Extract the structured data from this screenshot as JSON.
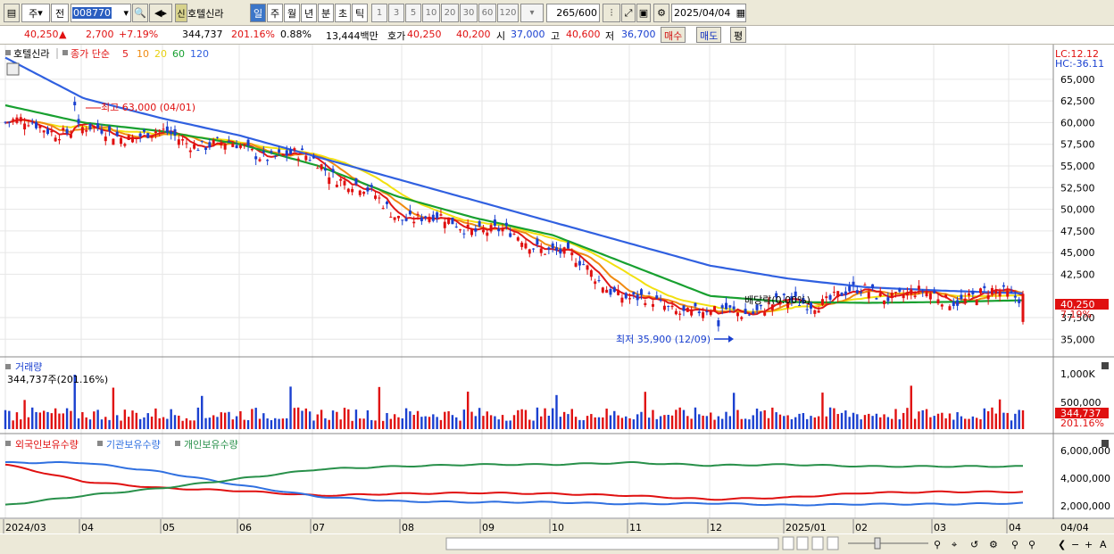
{
  "toolbar": {
    "period_code": "주",
    "mode": "전",
    "stock_code": "008770",
    "stock_name": "호텔신라",
    "badge": "신",
    "timeframes": [
      "일",
      "주",
      "월",
      "년",
      "분",
      "초",
      "틱"
    ],
    "minute_options": [
      "1",
      "3",
      "5",
      "10",
      "20",
      "30",
      "60",
      "120"
    ],
    "count": "265",
    "count_max": "/600",
    "date": "2025/04/04"
  },
  "quote": {
    "price": "40,250",
    "direction": "▲",
    "change": "2,700",
    "change_pct": "+7.19%",
    "volume": "344,737",
    "vol_ratio": "201.16%",
    "turnover_ratio": "0.88%",
    "trade_amount": "13,444백만",
    "hoga_label": "호가",
    "ask": "40,250",
    "bid": "40,200",
    "open_label": "시",
    "open": "37,000",
    "high_label": "고",
    "high": "40,600",
    "low_label": "저",
    "low": "36,700",
    "buy_label": "매수",
    "sell_label": "매도",
    "avg_label": "평"
  },
  "main_panel": {
    "name": "호텔신라",
    "close_label": "종가 단순",
    "ma_labels": [
      "5",
      "10",
      "20",
      "60",
      "120"
    ],
    "max_annotation": "최고 63,000 (04/01)",
    "min_annotation": "최저 35,900 (12/09)",
    "dividend_annotation": "배당락(0.00%)",
    "lc": "LC:12.12",
    "hc": "HC:-36.11",
    "price_tag": "40,250",
    "pct_tag": "7.19%",
    "yticks": [
      "65,000",
      "62,500",
      "60,000",
      "57,500",
      "55,000",
      "52,500",
      "50,000",
      "47,500",
      "45,000",
      "42,500",
      "37,500",
      "35,000"
    ]
  },
  "volume_panel": {
    "title": "거래량",
    "value": "344,737주(201.16%)",
    "yticks": [
      "1,000K",
      "500,000"
    ],
    "tag": "344,737",
    "tag_pct": "201.16%"
  },
  "holdings_panel": {
    "legend": [
      "외국인보유수량",
      "기관보유수량",
      "개인보유수량"
    ],
    "yticks": [
      "6,000,000",
      "4,000,000",
      "2,000,000"
    ]
  },
  "xaxis": {
    "labels": [
      "2024/03",
      "04",
      "05",
      "06",
      "07",
      "08",
      "09",
      "10",
      "11",
      "12",
      "2025/01",
      "02",
      "03",
      "04"
    ],
    "right_label": "04/04"
  },
  "colors": {
    "up": "#e01010",
    "down": "#1a40d0",
    "ma5": "#e01818",
    "ma10": "#f08a10",
    "ma20": "#f2e010",
    "ma60": "#18a030",
    "ma120": "#3060e0",
    "foreign": "#e01010",
    "institution": "#3070e0",
    "individual": "#28904a"
  },
  "chart_data": {
    "type": "candlestick",
    "x": [
      "2024/03",
      "04",
      "05",
      "06",
      "07",
      "08",
      "09",
      "10",
      "11",
      "12",
      "2025/01",
      "02",
      "03",
      "04"
    ],
    "close_approx": [
      60000,
      59000,
      58500,
      57000,
      55500,
      49500,
      48000,
      45500,
      39500,
      38000,
      39000,
      40500,
      39800,
      40250
    ],
    "ma120_approx": [
      67500,
      62800,
      60500,
      58500,
      56000,
      53500,
      51000,
      48500,
      46000,
      43500,
      42000,
      41000,
      40600,
      40300
    ],
    "ma60_approx": [
      62000,
      60000,
      59000,
      57500,
      55000,
      51500,
      49000,
      47000,
      43500,
      40000,
      39300,
      39200,
      39300,
      39500
    ],
    "high": 63000,
    "high_date": "04/01",
    "low": 35900,
    "low_date": "12/09",
    "ylim": [
      34000,
      69000
    ],
    "volume_ylim": [
      0,
      1000000
    ],
    "holdings": [
      {
        "name": "외국인보유수량",
        "values_approx": [
          5800000,
          4000000,
          3300000,
          3000000,
          2500000,
          2700000,
          2800000,
          2700000,
          2500000,
          2100000,
          2300000,
          2800000,
          2900000,
          2900000
        ]
      },
      {
        "name": "기관보유수량",
        "values_approx": [
          6000000,
          6000000,
          5000000,
          3600000,
          2400000,
          1900000,
          1800000,
          1800000,
          1600000,
          1700000,
          1500000,
          1600000,
          1600000,
          1700000
        ]
      },
      {
        "name": "개인보유수량",
        "values_approx": [
          1500000,
          2500000,
          3300000,
          4300000,
          5300000,
          5600000,
          5800000,
          5800000,
          6000000,
          5700000,
          5800000,
          5600000,
          5600000,
          5600000
        ]
      }
    ]
  }
}
